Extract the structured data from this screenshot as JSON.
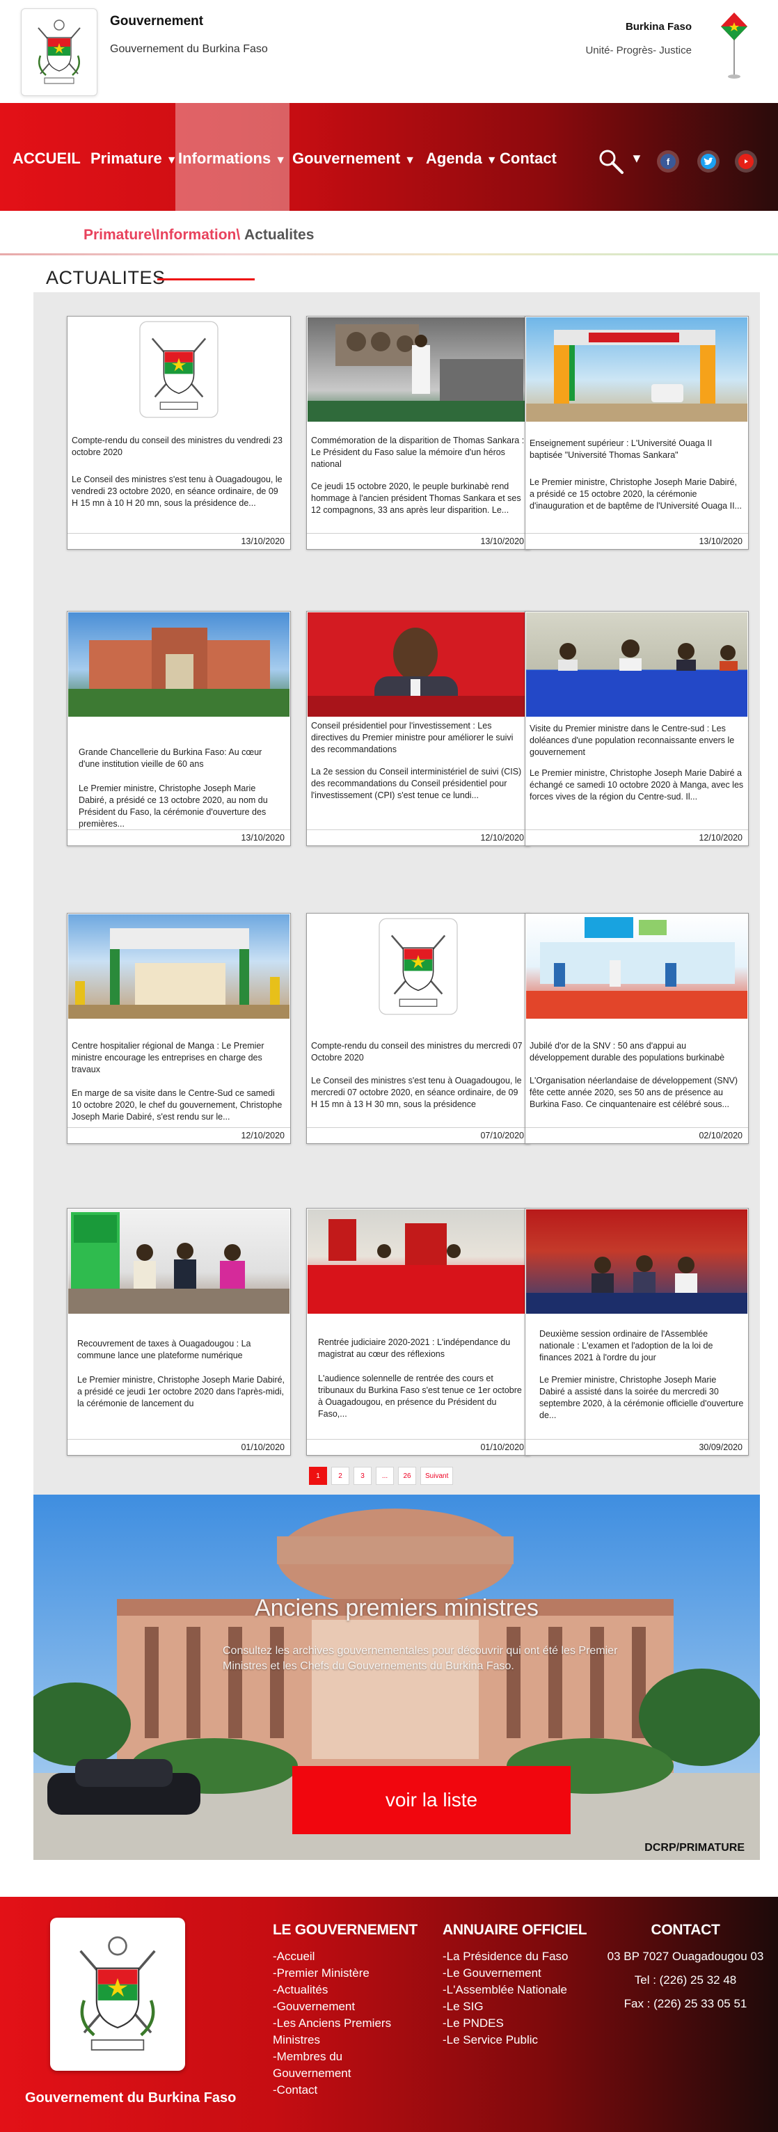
{
  "header": {
    "title": "Gouvernement",
    "subtitle": "Gouvernement du Burkina Faso",
    "country": "Burkina Faso",
    "motto": "Unité- Progrès- Justice"
  },
  "nav": {
    "items": [
      {
        "label": "ACCUEIL",
        "caret": ""
      },
      {
        "label": "Primature",
        "caret": "▼"
      },
      {
        "label": "Informations",
        "caret": "▼"
      },
      {
        "label": "Gouvernement",
        "caret": "▼"
      },
      {
        "label": "Agenda",
        "caret": "▼"
      },
      {
        "label": "Contact",
        "caret": ""
      }
    ],
    "search_caret": "▼",
    "social": [
      "facebook-icon",
      "twitter-icon",
      "youtube-icon"
    ]
  },
  "breadcrumb": {
    "path": "Primature\\Information\\",
    "current": "Actualites"
  },
  "section": {
    "title": "ACTUALITES"
  },
  "news": [
    {
      "title": "Compte-rendu du conseil des ministres du vendredi 23 octobre 2020",
      "excerpt": "Le Conseil des ministres s'est tenu à Ouagadougou, le vendredi 23 octobre 2020, en séance ordinaire, de 09 H 15 mn à 10 H 20 mn, sous la présidence de...",
      "date": "13/10/2020",
      "image": "coat-of-arms"
    },
    {
      "title": "Commémoration de la disparition de Thomas Sankara : Le Président du Faso salue la mémoire d'un héros national",
      "excerpt": "Ce jeudi 15 octobre 2020, le peuple burkinabè rend hommage à l'ancien président Thomas Sankara et ses 12 compagnons, 33 ans après leur disparition. Le...",
      "date": "13/10/2020",
      "image": "memorial"
    },
    {
      "title": "Enseignement supérieur : L'Université Ouaga II baptisée \"Université Thomas Sankara\"",
      "excerpt": "Le Premier ministre, Christophe Joseph Marie Dabiré, a présidé ce 15 octobre 2020, la cérémonie d'inauguration et de baptême de l'Université Ouaga II...",
      "date": "13/10/2020",
      "image": "gate"
    },
    {
      "title": "Grande Chancellerie du Burkina Faso: Au cœur d'une institution vieille de 60 ans",
      "excerpt": "Le Premier ministre, Christophe Joseph Marie Dabiré, a présidé ce 13 octobre 2020, au nom du Président du Faso, la cérémonie d'ouverture des premières...",
      "date": "13/10/2020",
      "image": "building"
    },
    {
      "title": "Conseil présidentiel pour l'investissement : Les directives du Premier ministre pour améliorer le suivi des recommandations",
      "excerpt": "La 2e session du Conseil interministériel de suivi (CIS) des recommandations du Conseil présidentiel pour l'investissement (CPI) s'est tenue ce lundi...",
      "date": "12/10/2020",
      "image": "portrait"
    },
    {
      "title": "Visite du Premier ministre dans le Centre-sud : Les doléances d'une population reconnaissante envers le gouvernement",
      "excerpt": "Le Premier ministre, Christophe Joseph Marie Dabiré a échangé ce samedi 10 octobre 2020 à Manga, avec les forces vives de la région du Centre-sud. Il...",
      "date": "12/10/2020",
      "image": "panel"
    },
    {
      "title": "Centre hospitalier régional de Manga : Le Premier ministre encourage les entreprises en charge des travaux",
      "excerpt": "En marge de sa visite dans le Centre-Sud ce samedi 10 octobre 2020, le chef du gouvernement, Christophe Joseph Marie Dabiré, s'est rendu sur le...",
      "date": "12/10/2020",
      "image": "site"
    },
    {
      "title": "Compte-rendu du conseil des ministres du mercredi 07 Octobre 2020",
      "excerpt": "Le Conseil des ministres s'est tenu à Ouagadougou, le mercredi 07 octobre 2020, en séance ordinaire, de 09 H 15 mn à 13 H 30 mn, sous la présidence",
      "date": "07/10/2020",
      "image": "coat-of-arms"
    },
    {
      "title": "Jubilé d'or de la SNV : 50 ans d'appui au développement durable des populations burkinabè",
      "excerpt": "L'Organisation néerlandaise de développement (SNV) fête cette année 2020, ses 50 ans de présence au Burkina Faso. Ce cinquantenaire est célébré sous...",
      "date": "02/10/2020",
      "image": "snv"
    },
    {
      "title": "Recouvrement de taxes à Ouagadougou : La commune lance une plateforme numérique",
      "excerpt": "Le Premier ministre, Christophe Joseph Marie Dabiré, a présidé ce jeudi 1er octobre 2020 dans l'après-midi, la cérémonie de lancement du",
      "date": "01/10/2020",
      "image": "launch"
    },
    {
      "title": "Rentrée judiciaire 2020-2021 : L'indépendance du magistrat au cœur des réflexions",
      "excerpt": "L'audience solennelle de rentrée des cours et tribunaux du Burkina Faso s'est tenue ce 1er octobre à Ouagadougou, en présence du Président du Faso,...",
      "date": "01/10/2020",
      "image": "court"
    },
    {
      "title": "Deuxième session ordinaire de l'Assemblée nationale : L'examen et l'adoption de la loi de finances 2021 à l'ordre du jour",
      "excerpt": "Le Premier ministre, Christophe Joseph Marie Dabiré a assisté dans la soirée du mercredi 30 septembre 2020, à la cérémonie officielle d'ouverture de...",
      "date": "30/09/2020",
      "image": "assembly"
    }
  ],
  "pagination": {
    "pages": [
      "1",
      "2",
      "3",
      "...",
      "26"
    ],
    "next": "Suivant",
    "active": "1"
  },
  "banner": {
    "title": "Anciens premiers ministres",
    "text": "Consultez les archives gouvernementales pour découvrir qui ont été les Premier Ministres et les Chefs du Gouvernements du Burkina Faso.",
    "button": "voir la liste",
    "credit": "DCRP/PRIMATURE"
  },
  "footer": {
    "brand": "Gouvernement du Burkina Faso",
    "gov": {
      "title": "LE GOUVERNEMENT",
      "items": [
        "-Accueil",
        "-Premier Ministère",
        "-Actualités",
        "-Gouvernement",
        "-Les Anciens Premiers Ministres",
        "-Membres du Gouvernement",
        "-Contact"
      ]
    },
    "annuaire": {
      "title": "ANNUAIRE OFFICIEL",
      "items": [
        "-La Présidence du Faso",
        "-Le Gouvernement",
        "-L'Assemblée Nationale",
        "-Le SIG",
        "-Le PNDES",
        "-Le Service Public"
      ]
    },
    "contact": {
      "title": "CONTACT",
      "items": [
        "03 BP 7027 Ouagadougou 03",
        "Tel : (226) 25 32 48",
        "Fax : (226) 25 33 05 51"
      ]
    }
  },
  "colors": {
    "brand_red": "#e31117",
    "dark": "#1d0a0a",
    "accent_pink": "#e8425c"
  }
}
